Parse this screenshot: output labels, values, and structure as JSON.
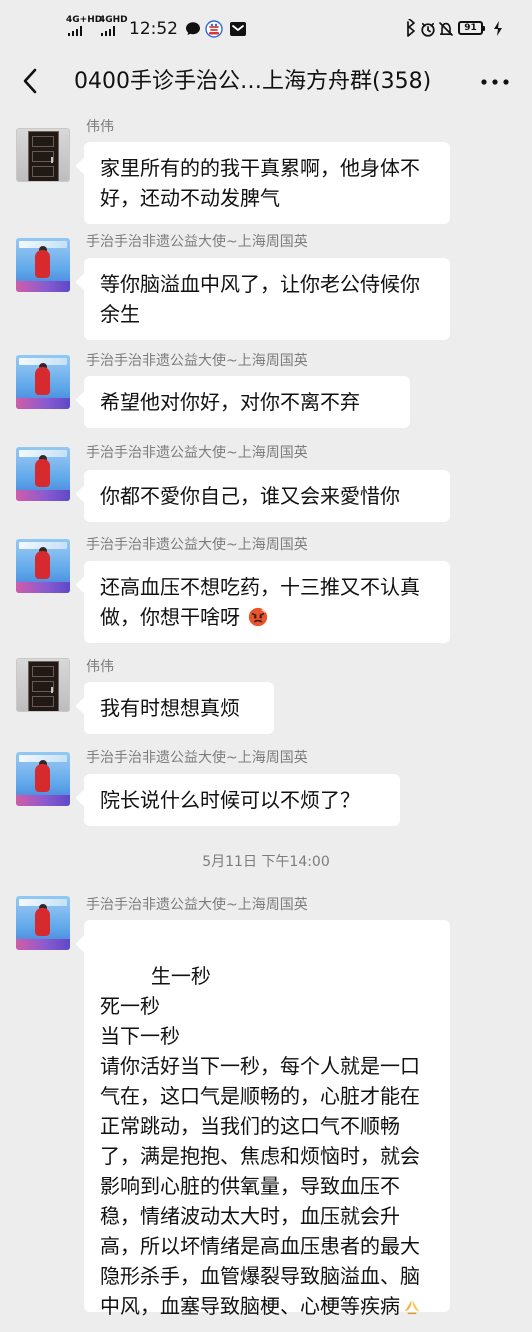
{
  "status_bar": {
    "network_1": "4G+HD",
    "network_2": "4GHD",
    "time": "12:52",
    "battery": "91"
  },
  "header": {
    "title": "0400手诊手治公…上海方舟群(358)"
  },
  "messages": [
    {
      "sender": "伟伟",
      "text": "家里所有的的我干真累啊，他身体不好，还动不动发脾气"
    },
    {
      "sender": "手治手治非遗公益大使~上海周国英",
      "text": "等你脑溢血中风了，让你老公侍候你余生"
    },
    {
      "sender": "手治手治非遗公益大使~上海周国英",
      "text": "希望他对你好，对你不离不弃"
    },
    {
      "sender": "手治手治非遗公益大使~上海周国英",
      "text": "你都不愛你自己，谁又会来愛惜你"
    },
    {
      "sender": "手治手治非遗公益大使~上海周国英",
      "text": "还高血压不想吃药，十三推又不认真做，你想干啥呀"
    },
    {
      "sender": "伟伟",
      "text": "我有时想想真烦"
    },
    {
      "sender": "手治手治非遗公益大使~上海周国英",
      "text": "院长说什么时候可以不烦了？"
    },
    {
      "sender": "手治手治非遗公益大使~上海周国英",
      "text": "生一秒\n死一秒\n当下一秒\n请你活好当下一秒，每个人就是一口气在，这口气是顺畅的，心脏才能在正常跳动，当我们的这口气不顺畅了，满是抱抱、焦虑和烦恼时，就会影响到心脏的供氧量，导致血压不稳，情绪波动太大时，血压就会升高，所以坏情绪是高血压患者的最大隐形杀手，血管爆裂导致脑溢血、脑中风，血塞导致脑梗、心梗等疾病"
    }
  ],
  "timestamp": "5月11日 下午14:00",
  "icons": {
    "back": "back-arrow-icon",
    "more": "more-icon",
    "emoji_angry": "angry-face-emoji",
    "emoji_hands": "praying-hands-emoji"
  },
  "colors": {
    "background": "#ededed",
    "bubble": "#ffffff",
    "meta_text": "#7d7d7d"
  }
}
